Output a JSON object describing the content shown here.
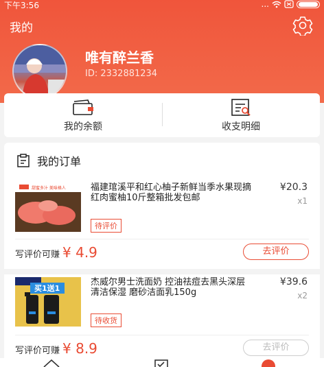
{
  "status": {
    "time": "下午3:56",
    "signal": "..."
  },
  "header": {
    "title": "我的",
    "username": "唯有醉兰香",
    "user_id": "ID: 2332881234"
  },
  "wallet": {
    "balance_label": "我的余额",
    "details_label": "收支明细"
  },
  "orders": {
    "section_title": "我的订单",
    "items": [
      {
        "name": "福建琯溪平和红心柚子新鲜当季水果现摘红肉蜜柚10斤整箱批发包邮",
        "price": "¥20.3",
        "qty": "x1",
        "status": "待评价",
        "earn_label": "写评价可赚",
        "earn_amount": "¥ 4.9",
        "action": "去评价",
        "action_enabled": true,
        "thumb_text": "甜蜜多汁 美味格人"
      },
      {
        "name": "杰威尔男士洗面奶  控油祛痘去黑头深层清洁保湿  磨砂洁面乳150g",
        "price": "¥39.6",
        "qty": "x2",
        "status": "待收货",
        "earn_label": "写评价可赚",
        "earn_amount": "¥ 8.9",
        "action": "去评价",
        "action_enabled": false,
        "thumb_text": "买1送1"
      }
    ]
  },
  "colors": {
    "accent": "#e94b33",
    "header": "#f0553b"
  }
}
